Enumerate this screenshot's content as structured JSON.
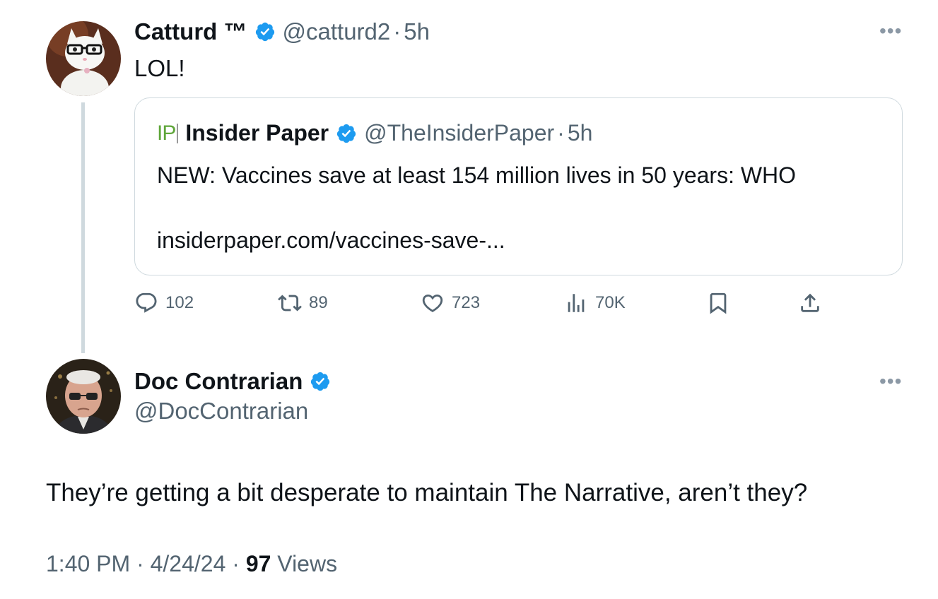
{
  "colors": {
    "verified": "#1d9bf0",
    "text": "#0f1419",
    "secondary": "#536471",
    "border": "#cfd9de",
    "brand_ip": "#5fa63a"
  },
  "parent_tweet": {
    "author_name": "Catturd ™",
    "author_handle": "@catturd2",
    "dot": "·",
    "time": "5h",
    "text": "LOL!",
    "more_icon": "more-dots-icon",
    "quoted": {
      "logo_text": "IP",
      "author_name": "Insider Paper",
      "author_handle": "@TheInsiderPaper",
      "dot": "·",
      "time": "5h",
      "text": "NEW: Vaccines save at least 154 million lives in 50 years: WHO",
      "link": "insiderpaper.com/vaccines-save-..."
    },
    "actions": {
      "replies": "102",
      "reposts": "89",
      "likes": "723",
      "views": "70K"
    }
  },
  "reply_tweet": {
    "author_name": "Doc Contrarian",
    "author_handle": "@DocContrarian",
    "text": "They’re getting a bit desperate to maintain The Narrative, aren’t they?",
    "footer": {
      "time": "1:40 PM",
      "sep1": " · ",
      "date": "4/24/24",
      "sep2": " · ",
      "views_count": "97",
      "views_label": " Views"
    }
  }
}
